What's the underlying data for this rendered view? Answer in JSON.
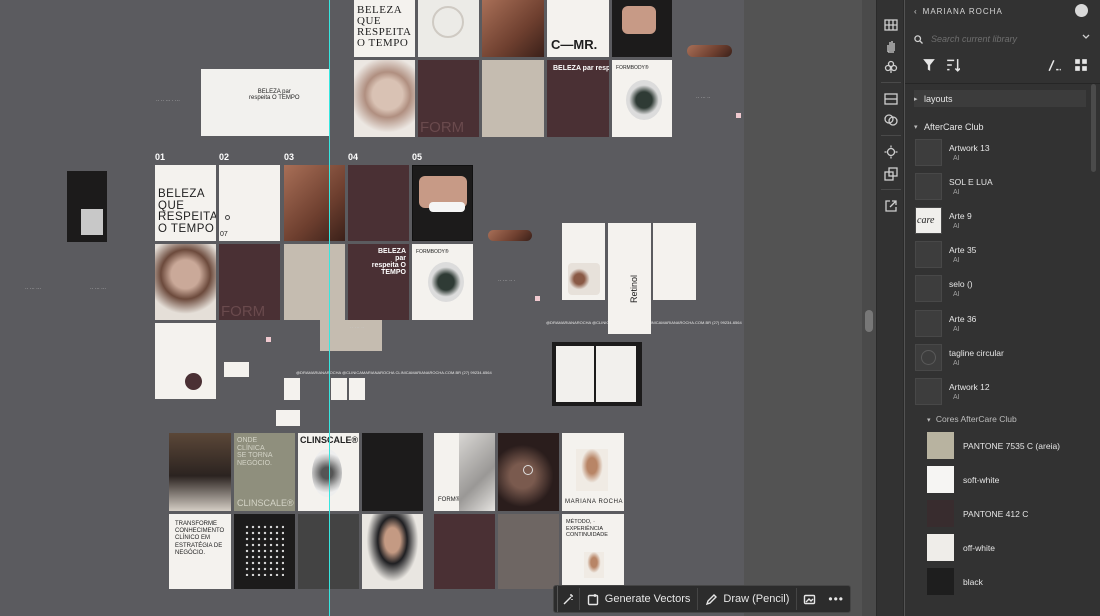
{
  "canvas": {
    "tiles": {
      "belezaTop": "BELEZA QUE RESPEITA O TEMPO",
      "belezaPar": "BELEZA par respeita O TEMPO",
      "belezaSmall": "BELEZA par\nrespeita O TEMPO",
      "belezaRow": "BELEZA QUE RESPEITA O TEMPO",
      "cmr": "C—MR.",
      "formBody": "FORMBODY®",
      "form": "FORM",
      "formReg": "FORM®",
      "retinol": "Retinol",
      "ondeClinica": "ONDE CLÍNICA SE TORNA NEGÓCIO.",
      "clinscale": "CLINSCALE®",
      "clinscaleTile": "CLINSCALE®",
      "transforme": "TRANSFORME CONHECIMENTO CLÍNICO EM ESTRATÉGIA DE NEGÓCIO.",
      "marianaRocha": "MARIANA ROCHA",
      "metodo": "MÉTODO, ·  EXPERIÊNCIA CONTINUIDADE",
      "page07": "07"
    },
    "numbers": [
      "01",
      "02",
      "03",
      "04",
      "05"
    ],
    "captions": {
      "row1": "@DRAMARIANAROCHA    @CLINICAMARIANAROCHA    CLINICAMARIANAROCHA.COM.BR    (27) 99234-6564",
      "row2": "@DRAMARIANAROCHA    @CLINICAMARIANAROCHA    CLINICAMARIANAROCHA.COM.BR    (27) 99234-6564"
    }
  },
  "contextBar": {
    "generate_label": "Generate Vectors",
    "draw_label": "Draw (Pencil)"
  },
  "libraries": {
    "title": "MARIANA ROCHA",
    "search_placeholder": "Search current library",
    "groups": {
      "layouts": "layouts",
      "aftercare": "AfterCare Club",
      "cores": "Cores AfterCare Club"
    },
    "assets": [
      {
        "name": "Artwork 13",
        "kind": "AI"
      },
      {
        "name": "SOL E LUA",
        "kind": "AI"
      },
      {
        "name": "Arte 9",
        "kind": "AI"
      },
      {
        "name": "Arte 35",
        "kind": "AI"
      },
      {
        "name": "selo ()",
        "kind": "AI"
      },
      {
        "name": "Arte 36",
        "kind": "AI"
      },
      {
        "name": "tagline circular",
        "kind": "AI"
      },
      {
        "name": "Artwork 12",
        "kind": "AI"
      }
    ],
    "arte9_thumb_text": "care",
    "colors": [
      {
        "name": "PANTONE 7535 C (areia)",
        "hex": "#b8b3a0"
      },
      {
        "name": "soft-white",
        "hex": "#f6f5f3"
      },
      {
        "name": "PANTONE 412 C",
        "hex": "#382c2e"
      },
      {
        "name": "off-white",
        "hex": "#efede9"
      },
      {
        "name": "black",
        "hex": "#1e1e1e"
      }
    ]
  }
}
